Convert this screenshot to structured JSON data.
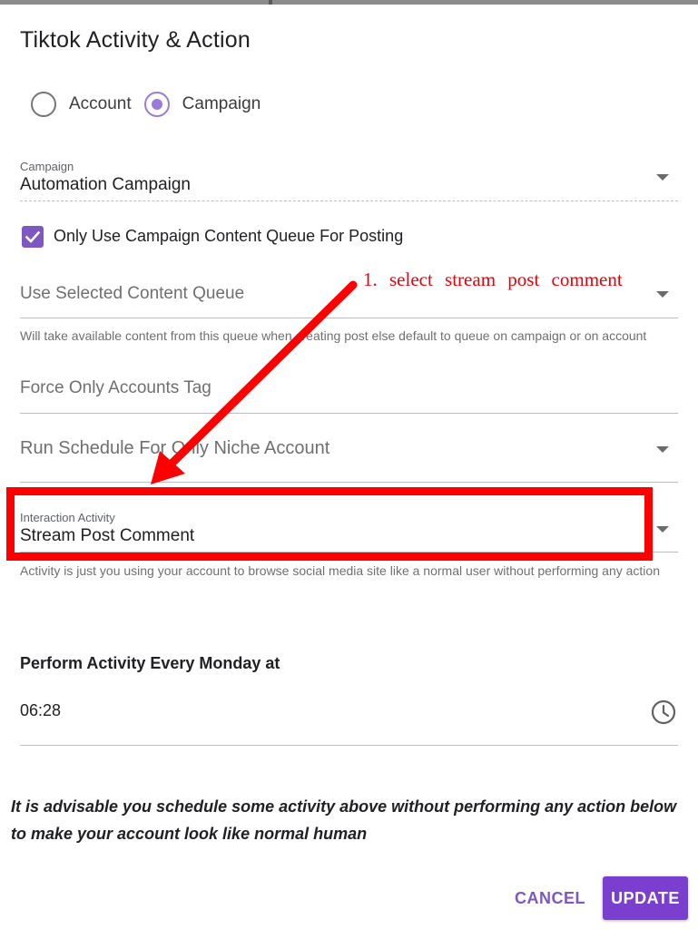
{
  "dialog": {
    "title": "Tiktok Activity & Action"
  },
  "target": {
    "options": [
      {
        "label": "Account",
        "selected": false
      },
      {
        "label": "Campaign",
        "selected": true
      }
    ]
  },
  "campaign_field": {
    "label": "Campaign",
    "value": "Automation Campaign"
  },
  "content_queue_checkbox": {
    "label": "Only Use Campaign Content Queue For Posting",
    "checked": true
  },
  "content_queue_field": {
    "placeholder": "Use Selected Content Queue",
    "helper": "Will take available content from this queue when creating post else default to queue on campaign or on account"
  },
  "accounts_tag_field": {
    "placeholder": "Force Only Accounts Tag"
  },
  "niche_schedule_field": {
    "placeholder": "Run Schedule For Only Niche Account"
  },
  "interaction_activity_field": {
    "label": "Interaction Activity",
    "value": "Stream Post Comment",
    "helper": "Activity is just you using your account to browse social media site like a normal user without performing any action"
  },
  "schedule": {
    "heading": "Perform Activity Every Monday at",
    "time": "06:28"
  },
  "advice_text": "It is advisable you schedule some activity above without performing any action below to make your account look like normal human",
  "actions": {
    "cancel_label": "CANCEL",
    "update_label": "UPDATE"
  },
  "annotation": {
    "text": "1.  select  stream  post  comment"
  },
  "colors": {
    "accent": "#7e57c2",
    "update_button": "#7b3fd0",
    "annotation_red": "#ff0000"
  },
  "icons": [
    "radio-icon",
    "checkbox-check-icon",
    "dropdown-caret-icon",
    "clock-icon",
    "annotation-arrow"
  ]
}
